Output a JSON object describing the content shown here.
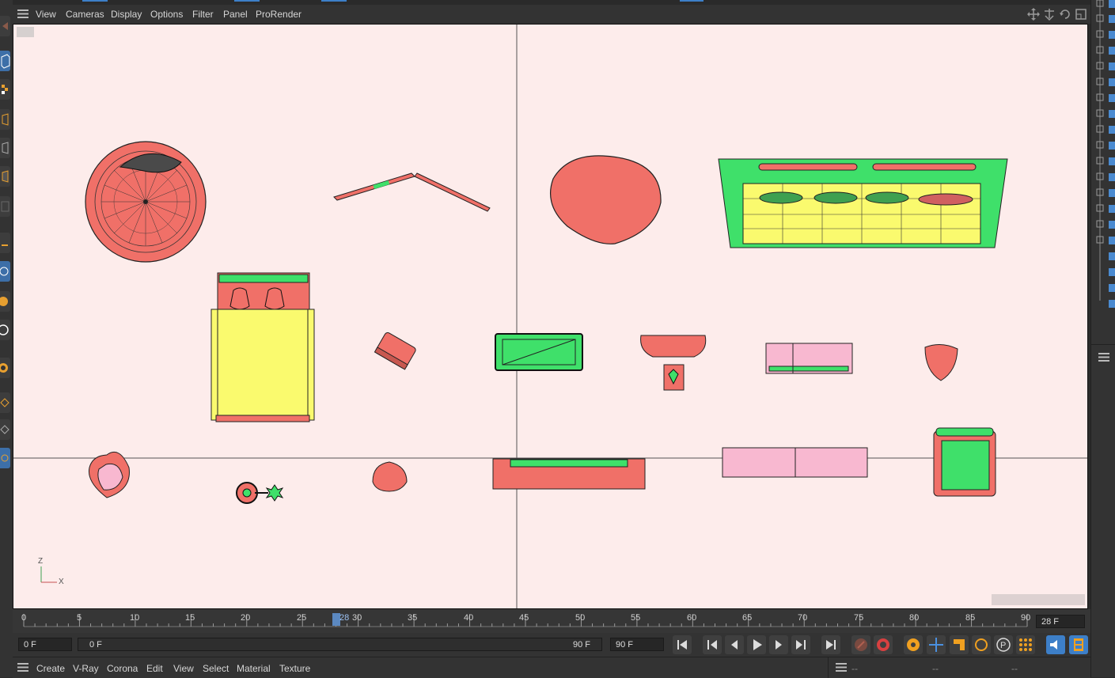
{
  "menubar": {
    "items": [
      "View",
      "Cameras",
      "Display",
      "Options",
      "Filter",
      "Panel",
      "ProRender"
    ]
  },
  "viewport": {
    "axis_z": "Z",
    "axis_x": "X"
  },
  "timeline": {
    "ticks": [
      "0",
      "5",
      "10",
      "15",
      "20",
      "25",
      "28",
      "30",
      "35",
      "40",
      "45",
      "50",
      "55",
      "60",
      "65",
      "70",
      "75",
      "80",
      "85",
      "90"
    ],
    "current_frame_marker": "28",
    "current_frame_field": "28 F"
  },
  "transport": {
    "start_field": "0 F",
    "range_start": "0 F",
    "range_end": "90 F",
    "end_field": "90 F"
  },
  "bottom_menu": {
    "items": [
      "Create",
      "V-Ray",
      "Corona",
      "Edit",
      "View",
      "Select",
      "Material",
      "Texture"
    ],
    "right_placeholders": [
      "--",
      "--",
      "--"
    ]
  },
  "colors": {
    "viewport_bg": "#fdeceb",
    "object_red": "#f07068",
    "object_green": "#3fe06a",
    "object_yellow": "#fafa6e",
    "object_pink": "#f8b8d0",
    "accent_blue": "#3d7fc8",
    "accent_orange": "#f0a020"
  },
  "icons": [
    "hamburger-icon",
    "move-icon",
    "pan-icon",
    "rotate-icon",
    "maximize-icon",
    "go-start-icon",
    "prev-key-icon",
    "prev-frame-icon",
    "play-icon",
    "next-frame-icon",
    "next-key-icon",
    "go-end-icon",
    "record-icon",
    "autokey-icon",
    "keyframe-icon",
    "position-key-icon",
    "scale-key-icon",
    "rotation-key-icon",
    "param-key-icon",
    "pla-key-icon",
    "sound-icon",
    "film-icon"
  ]
}
